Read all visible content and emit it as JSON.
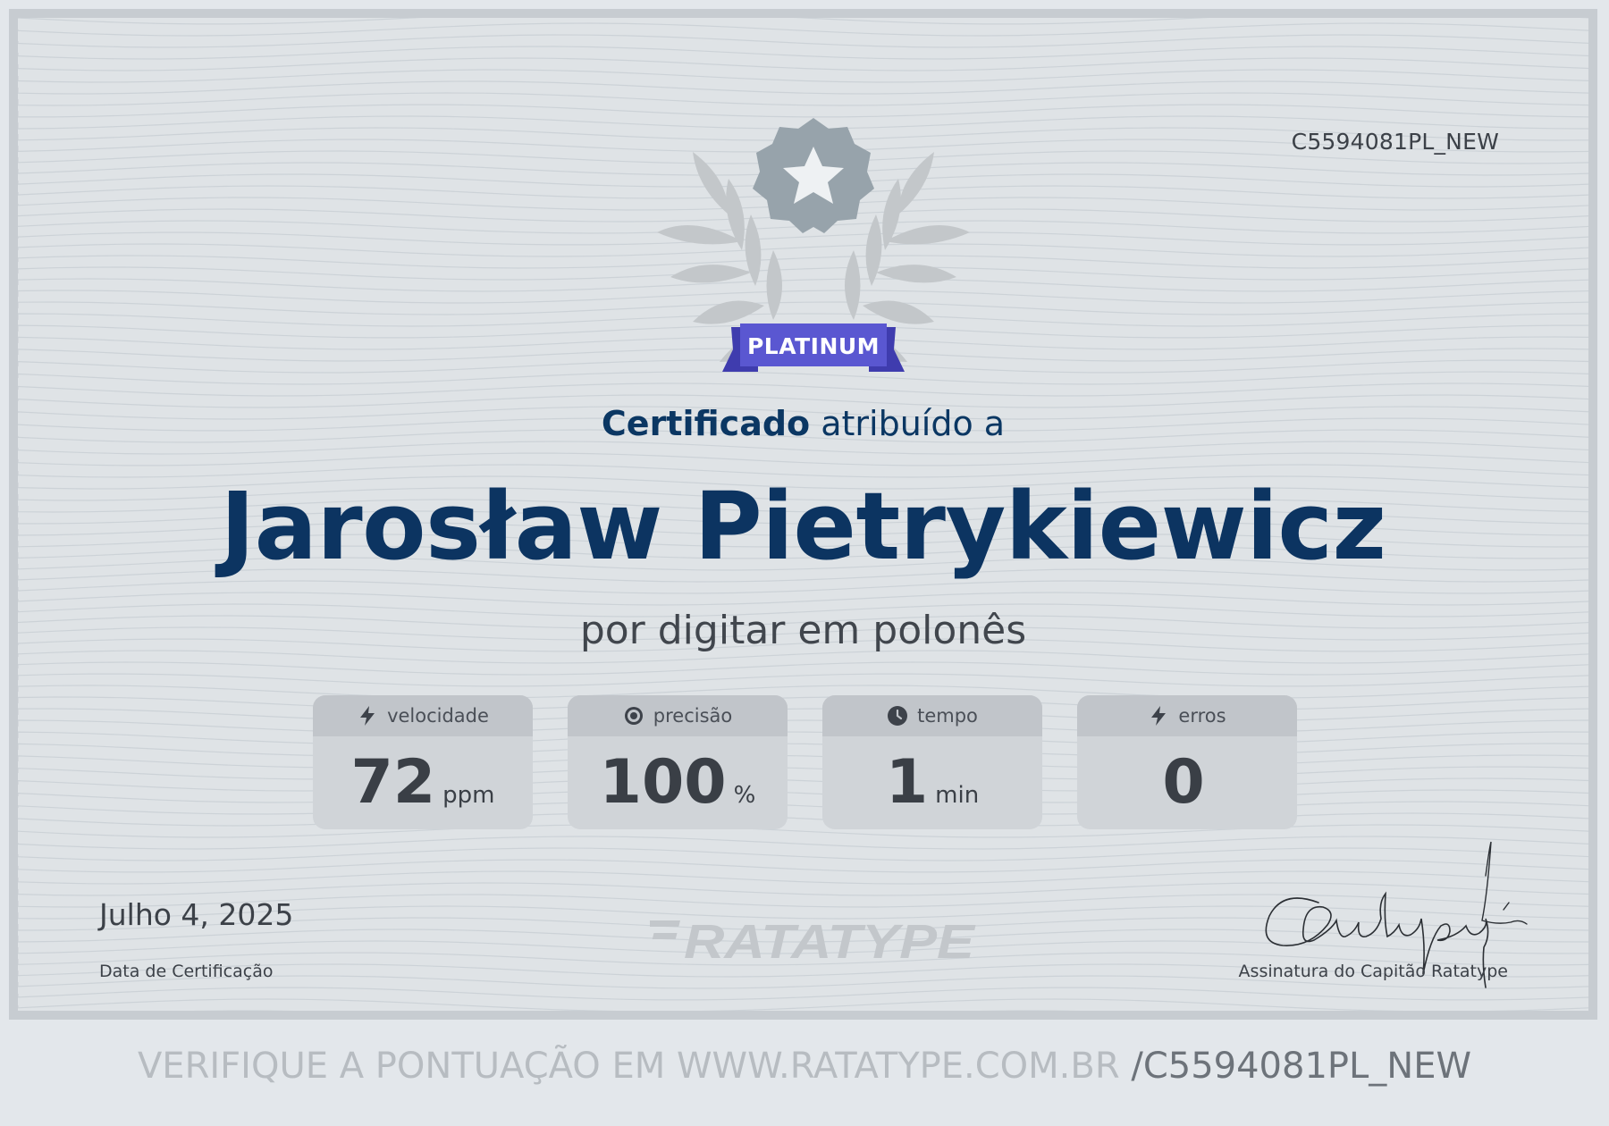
{
  "certificate": {
    "id": "C5594081PL_NEW",
    "badge": "PLATINUM",
    "title_bold": "Certificado",
    "title_rest": " atribuído a",
    "recipient": "Jarosław Pietrykiewicz",
    "reason": "por digitar em polonês",
    "stats": [
      {
        "label": "velocidade",
        "value": "72",
        "unit": "ppm",
        "icon": "bolt-icon"
      },
      {
        "label": "precisão",
        "value": "100",
        "unit": "%",
        "icon": "target-icon"
      },
      {
        "label": "tempo",
        "value": "1",
        "unit": "min",
        "icon": "clock-icon"
      },
      {
        "label": "erros",
        "value": "0",
        "unit": "",
        "icon": "bolt-icon"
      }
    ],
    "date": "Julho 4, 2025",
    "date_label": "Data de Certificação",
    "brand": "RATATYPE",
    "signature_label": "Assinatura do Capitão Ratatype"
  },
  "footer": {
    "verify_text": "VERIFIQUE A PONTUAÇÃO EM WWW.RATATYPE.COM.BR ",
    "verify_code": "/C5594081PL_NEW"
  },
  "colors": {
    "navy": "#0c3461",
    "badge": "#5a57d1",
    "medal": "#97a3ab"
  }
}
